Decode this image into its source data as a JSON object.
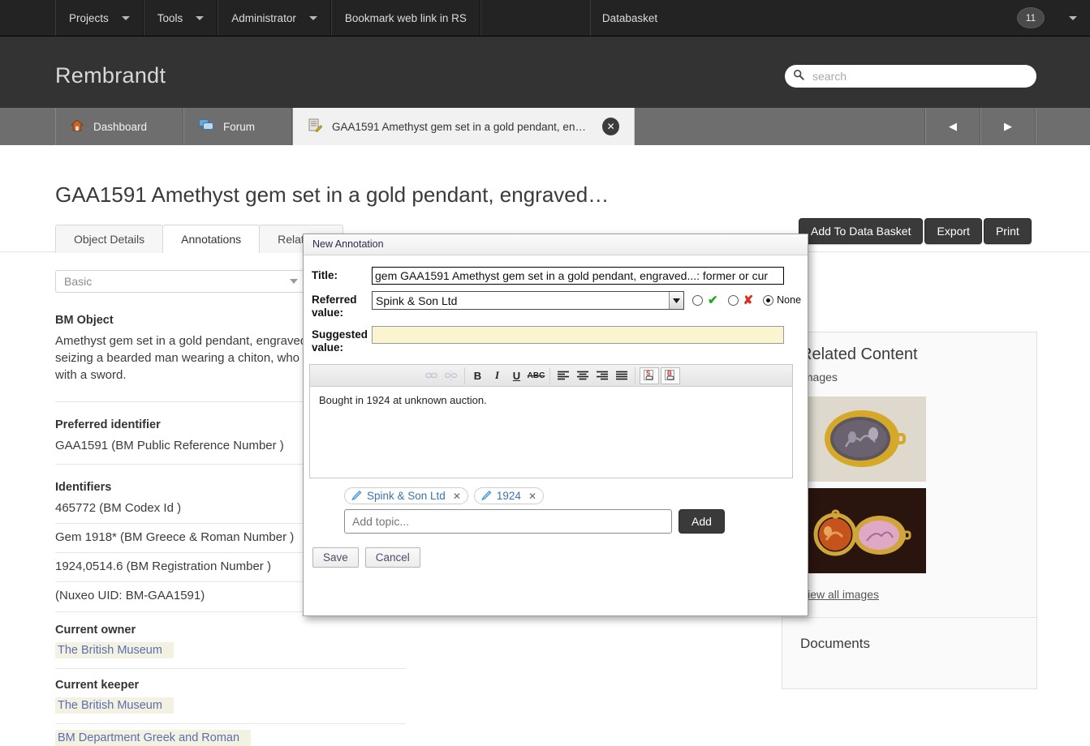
{
  "topnav": {
    "items": [
      {
        "label": "Projects",
        "caret": true
      },
      {
        "label": "Tools",
        "caret": true
      },
      {
        "label": "Administrator",
        "caret": true
      },
      {
        "label": "Bookmark web link in RS",
        "caret": false
      }
    ],
    "databasket_label": "Databasket",
    "databasket_count": "11"
  },
  "brand": {
    "title": "Rembrandt",
    "search_placeholder": "search",
    "search_value": "",
    "search_icon": "search-icon"
  },
  "tabstrip": {
    "dashboard": "Dashboard",
    "forum": "Forum",
    "document": "GAA1591 Amethyst gem set in a gold pendant, engrav...",
    "prev_arrow": "◀",
    "next_arrow": "▶",
    "close_glyph": "✕"
  },
  "page": {
    "title": "GAA1591 Amethyst gem set in a gold pendant, engraved…",
    "actions": [
      "Add To Data Basket",
      "Export",
      "Print"
    ],
    "tabs": [
      {
        "label": "Object Details",
        "active": false
      },
      {
        "label": "Annotations",
        "active": true
      },
      {
        "label": "Relations",
        "active": false
      }
    ],
    "view_select": "Basic"
  },
  "details": {
    "bm_object_label": "BM Object",
    "bm_object_text": "Amethyst gem set in a gold pendant, engraved with a Sphinx seizing a bearded man wearing a chiton, who defends himself with a sword.",
    "preferred_identifier_label": "Preferred identifier",
    "preferred_identifier_value": "GAA1591 (BM Public Reference Number )",
    "identifiers_label": "Identifiers",
    "identifiers": [
      "465772 (BM Codex Id )",
      "Gem 1918* (BM Greece & Roman Number )",
      "1924,0514.6 (BM Registration Number )",
      "(Nuxeo UID: BM-GAA1591)"
    ],
    "current_owner_label": "Current owner",
    "current_owner_value": "The British Museum",
    "current_keeper_label": "Current keeper",
    "current_keeper_value": "The British Museum",
    "department_value": "BM Department Greek and Roman"
  },
  "related": {
    "title": "Related Content",
    "images_label": "Images",
    "view_all": "View all images",
    "documents_label": "Documents"
  },
  "dialog": {
    "header": "New Annotation",
    "title_label": "Title:",
    "title_value": "gem GAA1591 Amethyst gem set in a gold pendant, engraved...: former or cur",
    "referred_label": "Referred value:",
    "referred_value": "Spink & Son Ltd",
    "referred_caret": "▼",
    "approve_glyph": "✔",
    "reject_glyph": "✘",
    "none_label": "None",
    "suggested_label": "Suggested value:",
    "suggested_value": "",
    "editor_text": "Bought in 1924 at unknown auction.",
    "toolbar": [
      {
        "name": "link-icon",
        "glyph": "⚭",
        "disabled": true,
        "framed": false
      },
      {
        "name": "unlink-icon",
        "glyph": "⚮",
        "disabled": true,
        "framed": false
      },
      {
        "name": "bold-icon",
        "glyph": "B",
        "disabled": false,
        "framed": false
      },
      {
        "name": "italic-icon",
        "glyph": "I",
        "disabled": false,
        "framed": false
      },
      {
        "name": "underline-icon",
        "glyph": "U",
        "disabled": false,
        "framed": false
      },
      {
        "name": "strikethrough-icon",
        "glyph": "ABC",
        "disabled": false,
        "framed": false
      },
      {
        "name": "align-left-icon",
        "glyph": "≡",
        "disabled": false,
        "framed": false
      },
      {
        "name": "align-center-icon",
        "glyph": "≡",
        "disabled": false,
        "framed": false
      },
      {
        "name": "align-right-icon",
        "glyph": "≡",
        "disabled": false,
        "framed": false
      },
      {
        "name": "align-justify-icon",
        "glyph": "≡",
        "disabled": false,
        "framed": false
      },
      {
        "name": "subject-link-icon",
        "glyph": "S",
        "disabled": false,
        "framed": true
      },
      {
        "name": "body-link-icon",
        "glyph": "B",
        "disabled": false,
        "framed": true
      }
    ],
    "tags": [
      {
        "label": "Spink & Son Ltd",
        "remove": "✕"
      },
      {
        "label": "1924",
        "remove": "✕"
      }
    ],
    "add_topic_placeholder": "Add topic...",
    "add_topic_value": "",
    "add_button": "Add",
    "save_button": "Save",
    "cancel_button": "Cancel"
  }
}
